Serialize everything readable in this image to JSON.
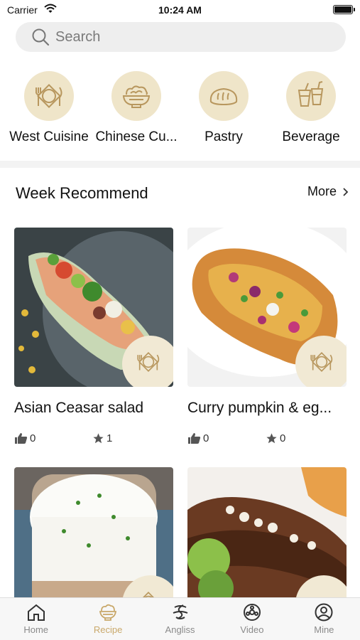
{
  "status_bar": {
    "carrier": "Carrier",
    "time": "10:24 AM"
  },
  "search": {
    "placeholder": "Search"
  },
  "categories": [
    {
      "label": "West Cuisine",
      "icon": "plate-fork-knife-icon"
    },
    {
      "label": "Chinese Cu...",
      "icon": "bowl-icon"
    },
    {
      "label": "Pastry",
      "icon": "bread-icon"
    },
    {
      "label": "Beverage",
      "icon": "drinks-icon"
    }
  ],
  "section": {
    "title": "Week Recommend",
    "more_label": "More"
  },
  "recipes": [
    {
      "title": "Asian Ceasar salad",
      "likes": "0",
      "stars": "1",
      "badge_icon": "plate-fork-knife-icon"
    },
    {
      "title": "Curry pumpkin & eg...",
      "likes": "0",
      "stars": "0",
      "badge_icon": "plate-fork-knife-icon"
    },
    {
      "title": "",
      "likes": "",
      "stars": "",
      "badge_icon": "plate-fork-knife-icon"
    },
    {
      "title": "",
      "likes": "",
      "stars": "",
      "badge_icon": "bowl-icon"
    }
  ],
  "tabs": [
    {
      "label": "Home",
      "icon": "home-icon",
      "active": false
    },
    {
      "label": "Recipe",
      "icon": "bowl-icon",
      "active": true
    },
    {
      "label": "Angliss",
      "icon": "angliss-logo-icon",
      "active": false
    },
    {
      "label": "Video",
      "icon": "video-reel-icon",
      "active": false
    },
    {
      "label": "Mine",
      "icon": "user-icon",
      "active": false
    }
  ],
  "colors": {
    "accent": "#c9a86a",
    "icon_circle": "#efe5c9",
    "icon_stroke": "#b8975e",
    "search_bg": "#eeeeee"
  }
}
